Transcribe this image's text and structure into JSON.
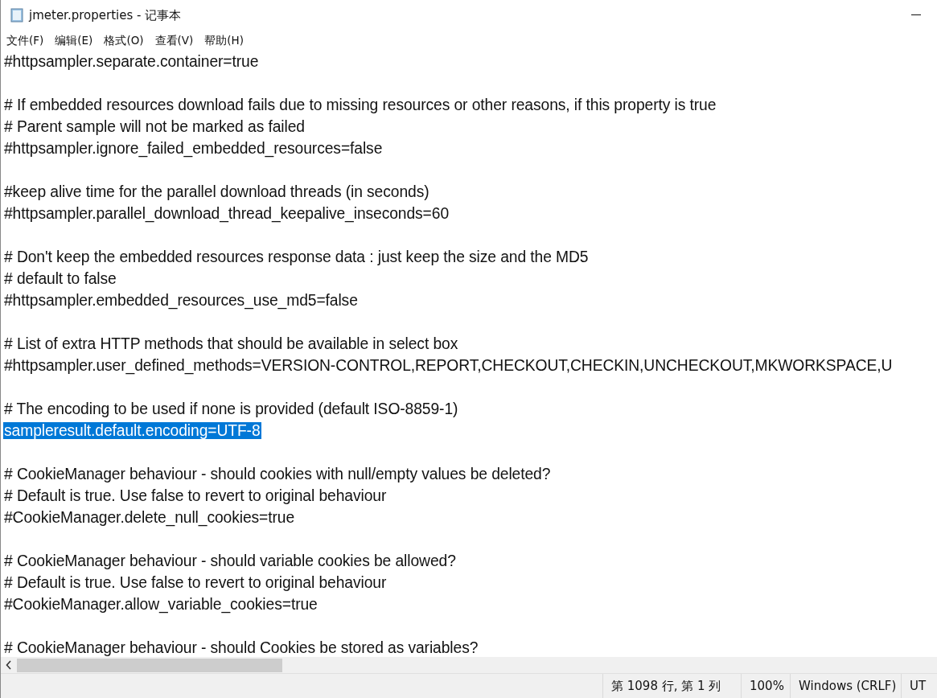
{
  "window": {
    "title": "jmeter.properties - 记事本"
  },
  "menu": [
    "文件(F)",
    "编辑(E)",
    "格式(O)",
    "查看(V)",
    "帮助(H)"
  ],
  "lines": [
    {
      "kind": "text",
      "text": "#httpsampler.separate.container=true",
      "selected": false
    },
    {
      "kind": "blank"
    },
    {
      "kind": "text",
      "text": "# If embedded resources download fails due to missing resources or other reasons, if this property is true",
      "selected": false
    },
    {
      "kind": "text",
      "text": "# Parent sample will not be marked as failed",
      "selected": false
    },
    {
      "kind": "text",
      "text": "#httpsampler.ignore_failed_embedded_resources=false",
      "selected": false
    },
    {
      "kind": "blank"
    },
    {
      "kind": "text",
      "text": "#keep alive time for the parallel download threads (in seconds)",
      "selected": false
    },
    {
      "kind": "text",
      "text": "#httpsampler.parallel_download_thread_keepalive_inseconds=60",
      "selected": false
    },
    {
      "kind": "blank"
    },
    {
      "kind": "text",
      "text": "# Don't keep the embedded resources response data : just keep the size and the MD5",
      "selected": false
    },
    {
      "kind": "text",
      "text": "# default to false",
      "selected": false
    },
    {
      "kind": "text",
      "text": "#httpsampler.embedded_resources_use_md5=false",
      "selected": false
    },
    {
      "kind": "blank"
    },
    {
      "kind": "text",
      "text": "# List of extra HTTP methods that should be available in select box",
      "selected": false
    },
    {
      "kind": "text",
      "text": "#httpsampler.user_defined_methods=VERSION-CONTROL,REPORT,CHECKOUT,CHECKIN,UNCHECKOUT,MKWORKSPACE,U",
      "selected": false
    },
    {
      "kind": "blank"
    },
    {
      "kind": "text",
      "text": "# The encoding to be used if none is provided (default ISO-8859-1)",
      "selected": false
    },
    {
      "kind": "text",
      "text": "sampleresult.default.encoding=UTF-8",
      "selected": true
    },
    {
      "kind": "blank"
    },
    {
      "kind": "text",
      "text": "# CookieManager behaviour - should cookies with null/empty values be deleted?",
      "selected": false
    },
    {
      "kind": "text",
      "text": "# Default is true. Use false to revert to original behaviour",
      "selected": false
    },
    {
      "kind": "text",
      "text": "#CookieManager.delete_null_cookies=true",
      "selected": false
    },
    {
      "kind": "blank"
    },
    {
      "kind": "text",
      "text": "# CookieManager behaviour - should variable cookies be allowed?",
      "selected": false
    },
    {
      "kind": "text",
      "text": "# Default is true. Use false to revert to original behaviour",
      "selected": false
    },
    {
      "kind": "text",
      "text": "#CookieManager.allow_variable_cookies=true",
      "selected": false
    },
    {
      "kind": "blank"
    },
    {
      "kind": "text",
      "text": "# CookieManager behaviour - should Cookies be stored as variables?",
      "selected": false
    }
  ],
  "status_bar": [
    "第 1098 行, 第 1 列",
    "100%",
    "Windows (CRLF)",
    "UT"
  ]
}
